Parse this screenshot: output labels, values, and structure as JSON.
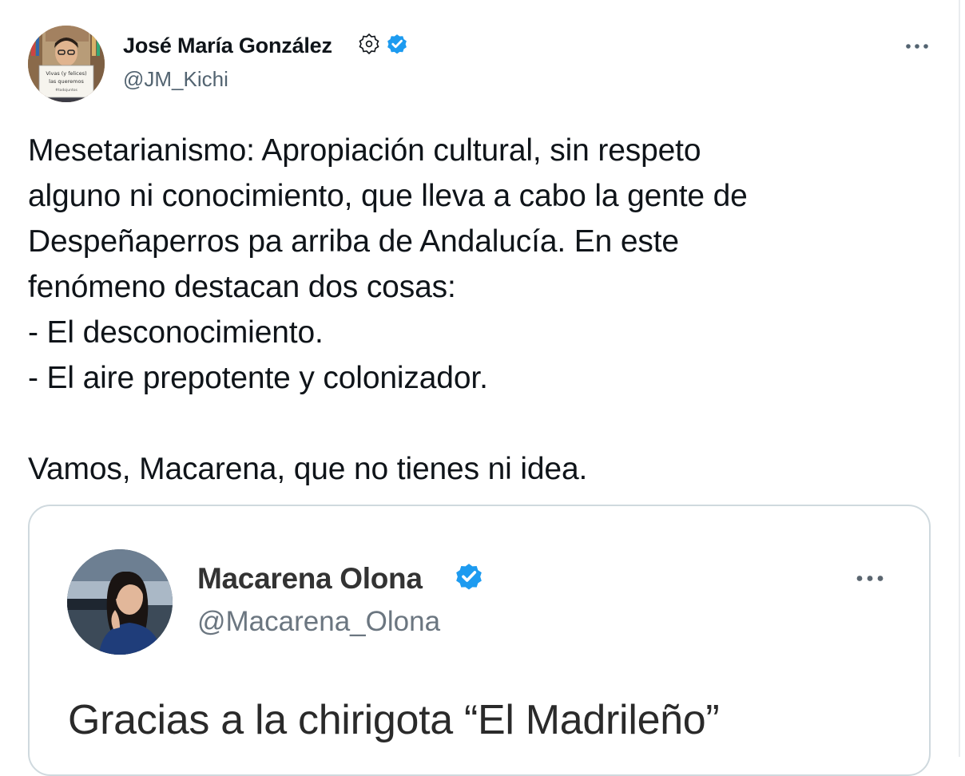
{
  "tweet": {
    "author": {
      "name": "José María González",
      "handle": "@JM_Kichi",
      "verified": true,
      "avatar_sign_text": [
        "Vivas (y felices)",
        "las queremos",
        "#todojuntos"
      ]
    },
    "text": "Mesetarianismo: Apropiación cultural, sin respeto\nalguno ni conocimiento, que lleva a cabo la gente de\nDespeñaperros pa arriba de Andalucía. En este\nfenómeno destacan dos cosas:\n- El desconocimiento.\n- El aire prepotente y colonizador.\n\nVamos, Macarena, que no tienes ni idea.",
    "more_icon": "more-horizontal-icon"
  },
  "quoted_tweet": {
    "author": {
      "name": "Macarena Olona",
      "handle": "@Macarena_Olona",
      "verified": true
    },
    "text": "Gracias a la chirigota “El Madrileño”",
    "more_icon": "more-horizontal-icon"
  },
  "colors": {
    "text_primary": "#0f1419",
    "text_secondary": "#536471",
    "verified_blue": "#1d9bf0",
    "card_border": "#cfd9de"
  }
}
